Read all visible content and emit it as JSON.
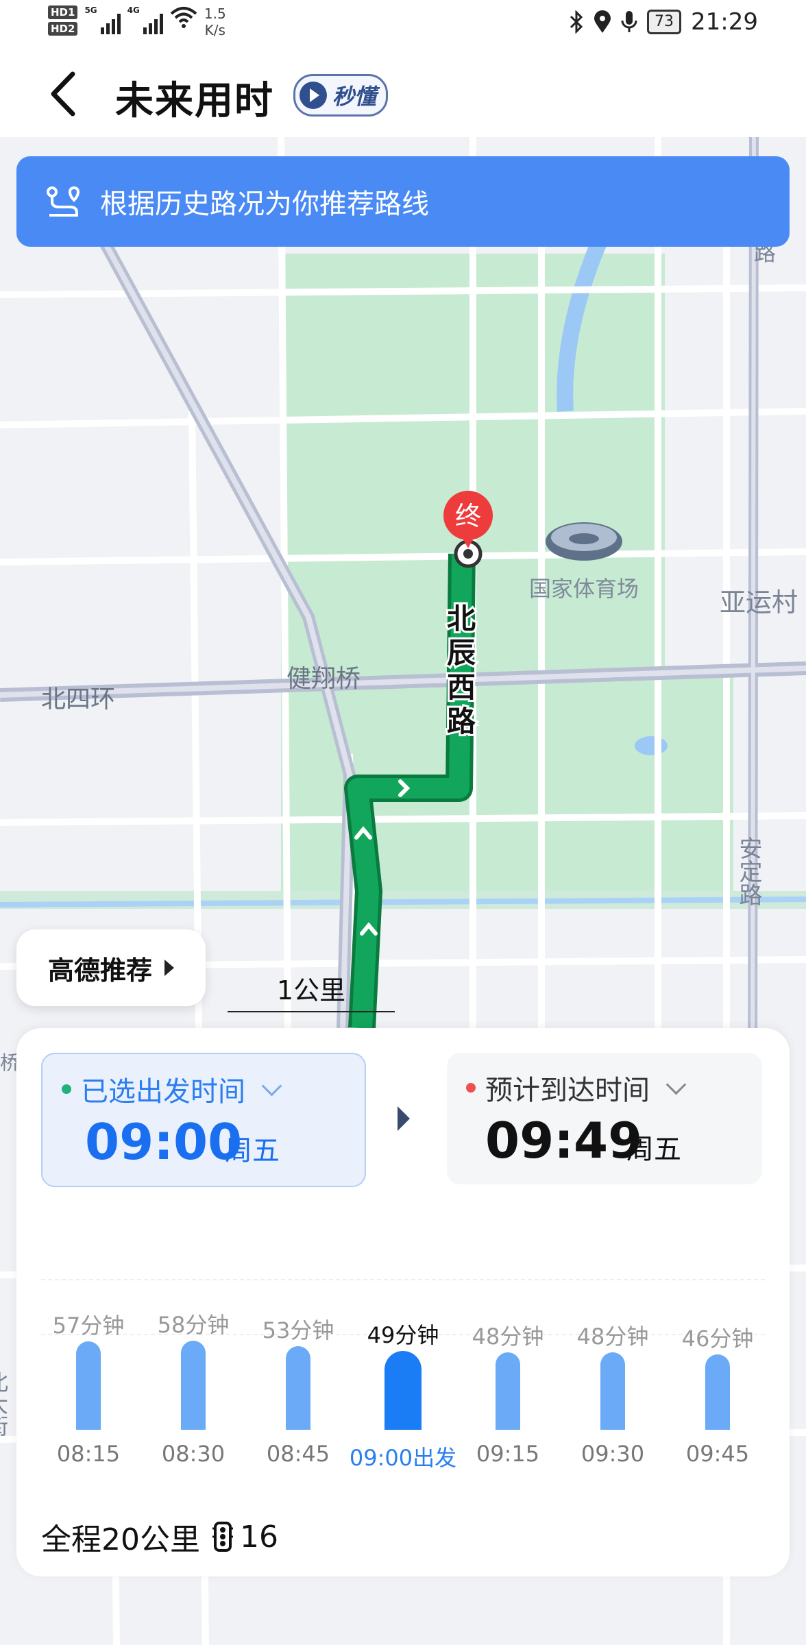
{
  "statusbar": {
    "hd1": "HD1",
    "hd2": "HD2",
    "net1": "5G",
    "net2": "4G",
    "speed_value": "1.5",
    "speed_unit": "K/s",
    "battery": "73",
    "time": "21:29"
  },
  "header": {
    "title": "未来用时",
    "badge": "秒懂"
  },
  "banner": {
    "text": "根据历史路况为你推荐路线"
  },
  "map": {
    "labels": {
      "end_marker": "终",
      "stadium": "国家体育场",
      "yayuncun": "亚运村",
      "ring": "北四环",
      "bridge": "健翔桥",
      "road_v1": "北辰西路",
      "road_v2": "安定路",
      "road_tr": "路",
      "edge_left": "北大街",
      "edge_mid": "桥"
    },
    "scale": "1公里",
    "route_color": "#12a65c"
  },
  "recommend_button": "高德推荐",
  "departure": {
    "label": "已选出发时间",
    "time": "09:00",
    "day": "周五",
    "dot_color": "#20b27a"
  },
  "arrival": {
    "label": "预计到达时间",
    "time": "09:49",
    "day": "周五",
    "dot_color": "#f05050"
  },
  "chart_data": {
    "type": "bar",
    "categories": [
      "08:15",
      "08:30",
      "08:45",
      "09:00出发",
      "09:15",
      "09:30",
      "09:45"
    ],
    "values": [
      57,
      58,
      53,
      49,
      48,
      48,
      46
    ],
    "value_labels": [
      "57分钟",
      "58分钟",
      "53分钟",
      "49分钟",
      "48分钟",
      "48分钟",
      "46分钟"
    ],
    "selected_index": 3,
    "unit": "分钟"
  },
  "summary": {
    "distance": "全程20公里",
    "lights": "16"
  }
}
